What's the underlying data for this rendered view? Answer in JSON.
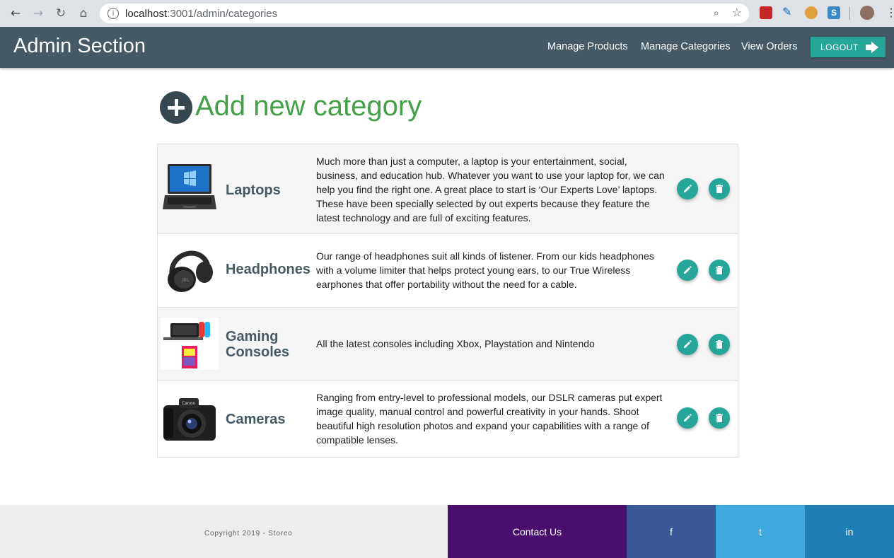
{
  "browser": {
    "url_host": "localhost",
    "url_rest": ":3001/admin/categories"
  },
  "header": {
    "title": "Admin Section",
    "nav": {
      "products": "Manage Products",
      "categories": "Manage Categories",
      "orders": "View Orders"
    },
    "logout_label": "LOGOUT"
  },
  "page": {
    "add_title": "Add new category"
  },
  "categories": [
    {
      "name": "Laptops",
      "description": "Much more than just a computer, a laptop is your entertainment, social, business, and education hub. Whatever you want to use your laptop for, we can help you find the right one. A great place to start is ‘Our Experts Love’ laptops. These have been specially selected by out experts because they feature the latest technology and are full of exciting features."
    },
    {
      "name": "Headphones",
      "description": "Our range of headphones suit all kinds of listener. From our kids headphones with a volume limiter that helps protect young ears, to our True Wireless earphones that offer portability without the need for a cable."
    },
    {
      "name": "Gaming Consoles",
      "description": "All the latest consoles including Xbox, Playstation and Nintendo"
    },
    {
      "name": "Cameras",
      "description": "Ranging from entry-level to professional models, our DSLR cameras put expert image quality, manual control and powerful creativity in your hands. Shoot beautiful high resolution photos and expand your capabilities with a range of compatible lenses."
    }
  ],
  "footer": {
    "copyright": "Copyright 2019 - Storeo",
    "contact": "Contact Us",
    "facebook": "f",
    "twitter": "t",
    "linkedin": "in"
  },
  "colors": {
    "header_bg": "#455a64",
    "accent_teal": "#26a69a",
    "title_green": "#43a047",
    "contact_bg": "#4a0f6e",
    "facebook_bg": "#3b5998",
    "twitter_bg": "#3ea9de",
    "linkedin_bg": "#1f7fb4"
  }
}
